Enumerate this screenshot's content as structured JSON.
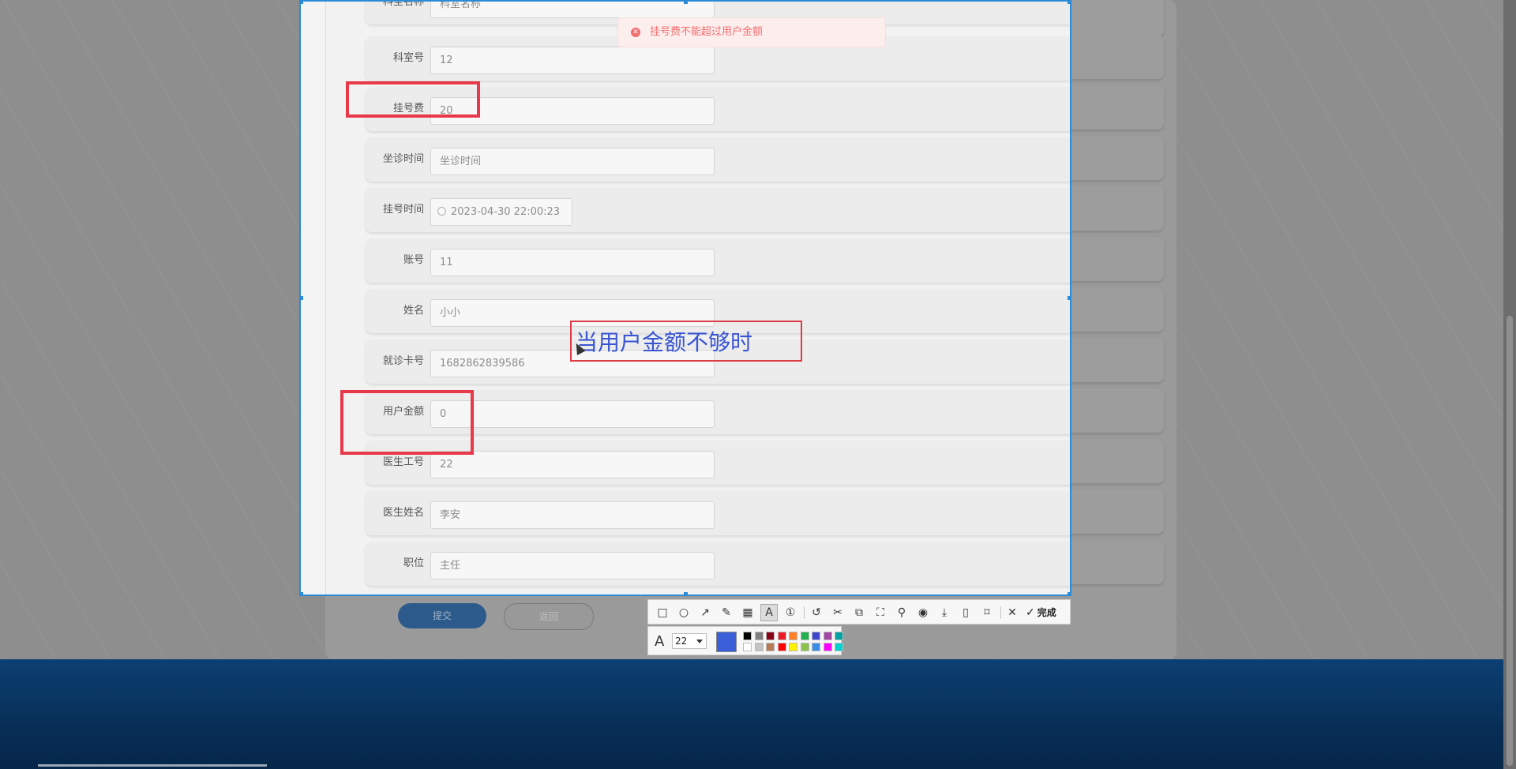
{
  "form": {
    "rows": [
      {
        "label": "科室名称",
        "value": "科室名称",
        "required": true
      },
      {
        "label": "科室号",
        "value": "12"
      },
      {
        "label": "挂号费",
        "value": "20"
      },
      {
        "label": "坐诊时间",
        "value": "坐诊时间"
      },
      {
        "label": "挂号时间",
        "value": "2023-04-30 22:00:23"
      },
      {
        "label": "账号",
        "value": "11"
      },
      {
        "label": "姓名",
        "value": "小小"
      },
      {
        "label": "就诊卡号",
        "value": "1682862839586"
      },
      {
        "label": "用户金额",
        "value": "0"
      },
      {
        "label": "医生工号",
        "value": "22"
      },
      {
        "label": "医生姓名",
        "value": "李安"
      },
      {
        "label": "职位",
        "value": "主任"
      }
    ],
    "required_mark": "*",
    "submit_label": "提交",
    "back_label": "返回"
  },
  "toast": {
    "message": "挂号费不能超过用户金额",
    "icon": "error-circle-icon"
  },
  "annotation": {
    "text": "当用户金额不够时",
    "text_color": "#3955d2",
    "box_color": "#e03a46",
    "highlight_color": "#e8394a"
  },
  "toolbar": {
    "done_label": "完成",
    "tools": [
      "rectangle-icon",
      "ellipse-icon",
      "arrow-icon",
      "pen-icon",
      "mosaic-icon",
      "text-icon",
      "serial-number-icon",
      "undo-icon",
      "cut-icon",
      "ocr-icon",
      "scan-icon",
      "pin-icon",
      "record-icon",
      "download-icon",
      "long-screenshot-icon",
      "bookmark-icon",
      "close-icon",
      "check-icon"
    ],
    "font_size": "22",
    "current_color": "#3b5fd9",
    "palette": [
      "#000000",
      "#7f7f7f",
      "#880015",
      "#ed1c24",
      "#ff7f27",
      "#22b14c",
      "#3f48cc",
      "#a349a4",
      "#00a2a2",
      "#ffffff",
      "#c3c3c3",
      "#b97a57",
      "#ff0000",
      "#fff200",
      "#8bc34a",
      "#3a8ee6",
      "#ff00ff",
      "#00d2d2"
    ]
  },
  "colors": {
    "capture_border": "#2a8bd8",
    "footer": "#0c3f73"
  }
}
